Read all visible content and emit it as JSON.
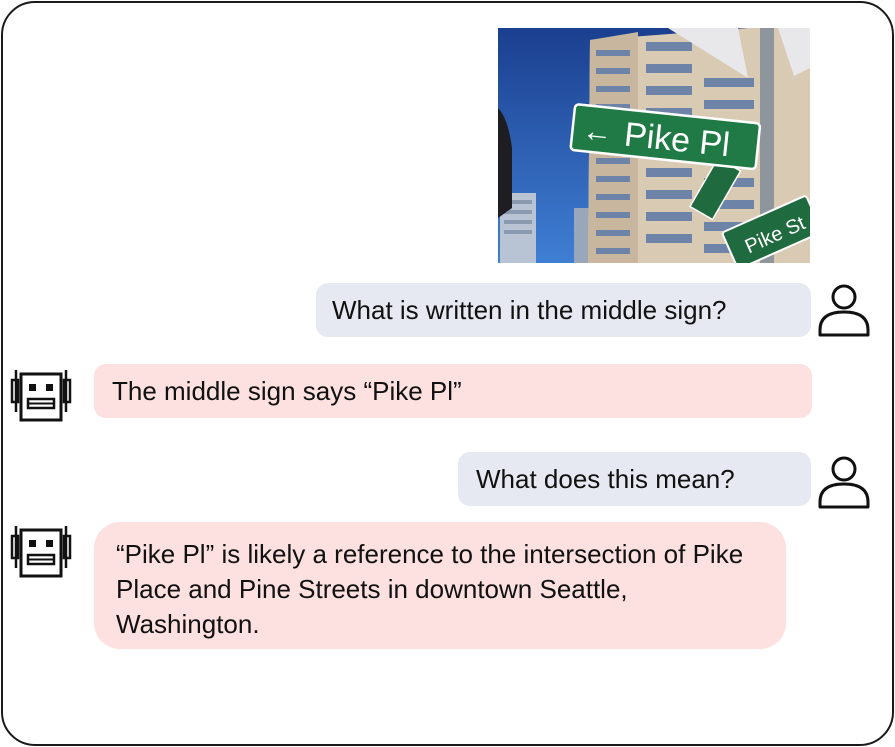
{
  "image": {
    "sign_main": "Pike Pl",
    "sign_back": "Pike St",
    "sign_arrow": "←"
  },
  "conversation": [
    {
      "role": "user",
      "text": "What is written in the middle sign?"
    },
    {
      "role": "assistant",
      "text": "The middle sign says “Pike Pl”"
    },
    {
      "role": "user",
      "text": "What does this mean?"
    },
    {
      "role": "assistant",
      "text": "“Pike Pl” is likely a reference to the intersection of Pike Place and Pine Streets in downtown Seattle, Washington."
    }
  ],
  "icons": {
    "user": "user-icon",
    "assistant": "robot-icon"
  },
  "colors": {
    "user_bubble": "#e6e9f1",
    "assistant_bubble": "#fde0e0",
    "sign_green": "#1f7a45"
  }
}
